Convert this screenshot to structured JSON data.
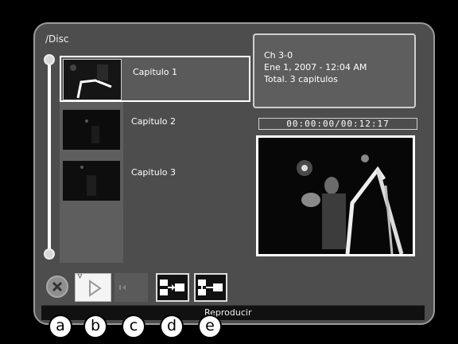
{
  "breadcrumb": {
    "path": "/Disc"
  },
  "chapters": [
    {
      "label": "Capitulo 1",
      "selected": true
    },
    {
      "label": "Capitulo 2",
      "selected": false
    },
    {
      "label": "Capitulo 3",
      "selected": false
    }
  ],
  "info": {
    "line1": "Ch 3-0",
    "line2": "Ene 1, 2007 - 12:04 AM",
    "line3": "Total. 3 capitulos"
  },
  "timecode": "00:00:00/00:12:17",
  "toolbar": {
    "buttons": [
      {
        "icon": "cancel-icon"
      },
      {
        "icon": "play-icon"
      },
      {
        "icon": "rewind-icon"
      },
      {
        "icon": "chapter-split-icon"
      },
      {
        "icon": "chapter-merge-icon"
      }
    ]
  },
  "status": {
    "text": "Reproducir"
  },
  "callouts": [
    "a",
    "b",
    "c",
    "d",
    "e"
  ]
}
